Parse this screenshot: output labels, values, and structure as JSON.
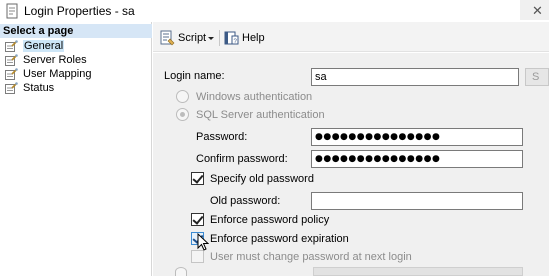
{
  "window": {
    "title": "Login Properties - sa",
    "close_glyph": "✕"
  },
  "left_pane": {
    "header": "Select a page",
    "pages": [
      {
        "label": "General",
        "icon": "wrench-page-icon",
        "active": true
      },
      {
        "label": "Server Roles",
        "icon": "wrench-page-icon",
        "active": false
      },
      {
        "label": "User Mapping",
        "icon": "wrench-page-icon",
        "active": false
      },
      {
        "label": "Status",
        "icon": "wrench-page-icon",
        "active": false
      }
    ]
  },
  "toolbar": {
    "script_label": "Script",
    "help_label": "Help"
  },
  "form": {
    "login_name_label": "Login name:",
    "login_name_value": "sa",
    "ellipsis_label": "S",
    "windows_auth_label": "Windows authentication",
    "sql_auth_label": "SQL Server authentication",
    "password_label": "Password:",
    "password_value": "●●●●●●●●●●●●●●●",
    "confirm_password_label": "Confirm password:",
    "confirm_password_value": "●●●●●●●●●●●●●●●",
    "specify_old_password_label": "Specify old password",
    "old_password_label": "Old password:",
    "old_password_value": "",
    "enforce_policy_label": "Enforce password policy",
    "enforce_expiration_label": "Enforce password expiration",
    "must_change_label": "User must change password at next login"
  },
  "colors": {
    "header_bg": "#d6e6f6",
    "content_bg": "#f0f0f0",
    "toolbar_bg": "#f3f3f3"
  }
}
